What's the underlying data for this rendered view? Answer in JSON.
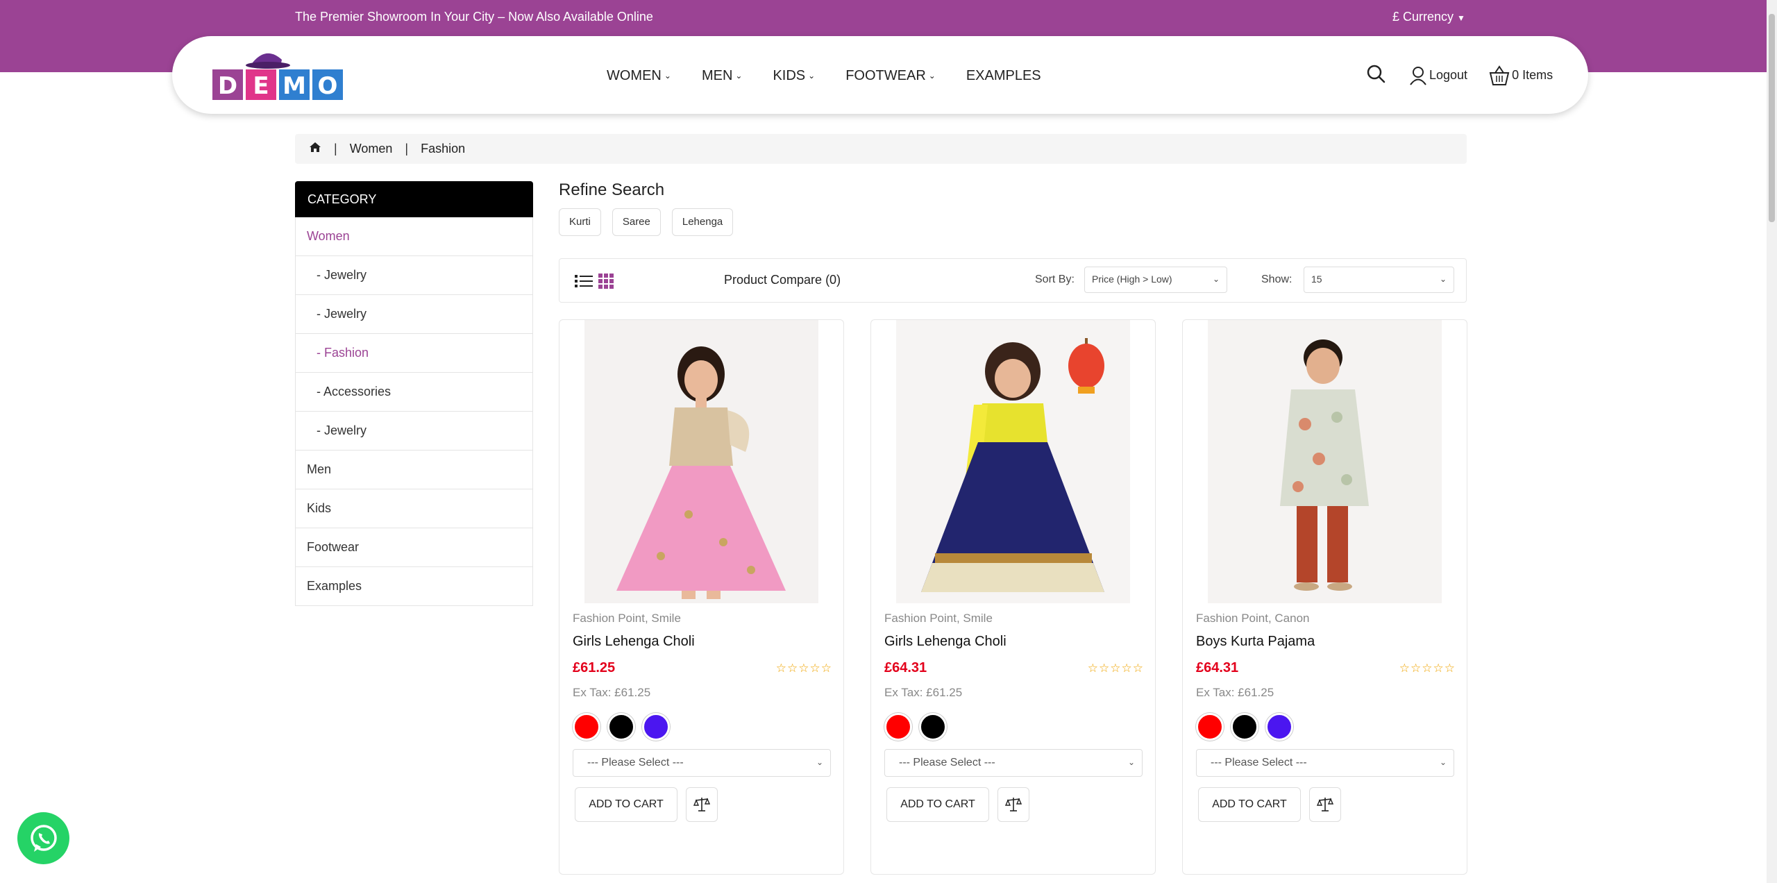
{
  "topbar": {
    "promo": "The Premier Showroom In Your City – Now Also Available Online",
    "currency": "£ Currency"
  },
  "logo": {
    "text": "DEMO"
  },
  "nav": [
    {
      "label": "WOMEN",
      "dropdown": true
    },
    {
      "label": "MEN",
      "dropdown": true
    },
    {
      "label": "KIDS",
      "dropdown": true
    },
    {
      "label": "FOOTWEAR",
      "dropdown": true
    },
    {
      "label": "EXAMPLES",
      "dropdown": false
    }
  ],
  "header_actions": {
    "logout": "Logout",
    "cart": "0 Items"
  },
  "breadcrumb": {
    "home_icon": "home-icon",
    "items": [
      "Women",
      "Fashion"
    ]
  },
  "sidebar": {
    "heading": "CATEGORY",
    "items": [
      {
        "label": "Women",
        "active": true,
        "sub": false
      },
      {
        "label": "- Jewelry",
        "active": false,
        "sub": true
      },
      {
        "label": "- Jewelry",
        "active": false,
        "sub": true
      },
      {
        "label": "- Fashion",
        "active": true,
        "sub": true
      },
      {
        "label": "- Accessories",
        "active": false,
        "sub": true
      },
      {
        "label": "- Jewelry",
        "active": false,
        "sub": true
      },
      {
        "label": "Men",
        "active": false,
        "sub": false
      },
      {
        "label": "Kids",
        "active": false,
        "sub": false
      },
      {
        "label": "Footwear",
        "active": false,
        "sub": false
      },
      {
        "label": "Examples",
        "active": false,
        "sub": false
      }
    ]
  },
  "refine": {
    "title": "Refine Search",
    "chips": [
      "Kurti",
      "Saree",
      "Lehenga"
    ]
  },
  "toolbar": {
    "compare": "Product Compare (0)",
    "sort_label": "Sort By:",
    "sort_value": "Price (High > Low)",
    "show_label": "Show:",
    "show_value": "15"
  },
  "products": [
    {
      "brand": "Fashion Point, Smile",
      "name": "Girls Lehenga Choli",
      "price": "£61.25",
      "ex_tax": "Ex Tax: £61.25",
      "stars": "☆☆☆☆☆",
      "option": "--- Please Select ---",
      "cart": "ADD TO CART",
      "swatches": [
        "#ff0000",
        "#000000",
        "#4b16f0"
      ],
      "image": "girl-pink-lehenga"
    },
    {
      "brand": "Fashion Point, Smile",
      "name": "Girls Lehenga Choli",
      "price": "£64.31",
      "ex_tax": "Ex Tax: £61.25",
      "stars": "☆☆☆☆☆",
      "option": "--- Please Select ---",
      "cart": "ADD TO CART",
      "swatches": [
        "#ff0000",
        "#000000"
      ],
      "image": "girl-navy-lehenga"
    },
    {
      "brand": "Fashion Point, Canon",
      "name": "Boys Kurta Pajama",
      "price": "£64.31",
      "ex_tax": "Ex Tax: £61.25",
      "stars": "☆☆☆☆☆",
      "option": "--- Please Select ---",
      "cart": "ADD TO CART",
      "swatches": [
        "#ff0000",
        "#000000",
        "#4b16f0"
      ],
      "image": "boy-kurta"
    }
  ],
  "colors": {
    "brand": "#9b4394",
    "price": "#e3001b",
    "star": "#f0a400",
    "whatsapp": "#25d366"
  }
}
